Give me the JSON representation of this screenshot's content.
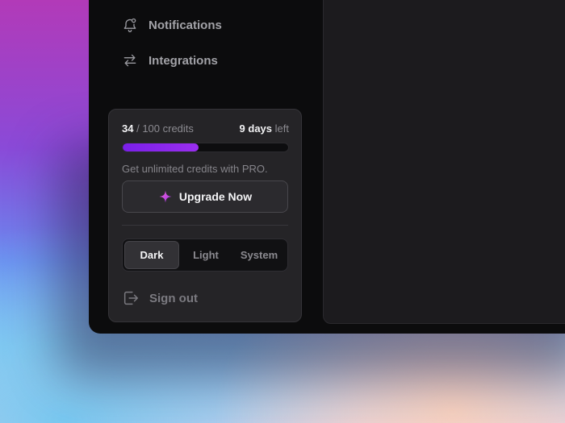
{
  "nav": {
    "items": [
      {
        "label": "Notifications",
        "icon": "bell-icon"
      },
      {
        "label": "Integrations",
        "icon": "arrows-swap-icon"
      }
    ]
  },
  "credits": {
    "used": "34",
    "total_text": "/ 100 credits",
    "days": "9 days",
    "days_suffix": "left",
    "progress_fraction": 0.46
  },
  "promo_text": "Get unlimited credits with PRO.",
  "upgrade": {
    "label": "Upgrade Now",
    "icon": "sparkle-icon"
  },
  "theme": {
    "options": [
      "Dark",
      "Light",
      "System"
    ],
    "selected": "Dark"
  },
  "signout": {
    "label": "Sign out",
    "icon": "sign-out-icon"
  },
  "colors": {
    "accent": "#8b2cf0",
    "panel": "#252427",
    "window": "#0c0c0d"
  }
}
